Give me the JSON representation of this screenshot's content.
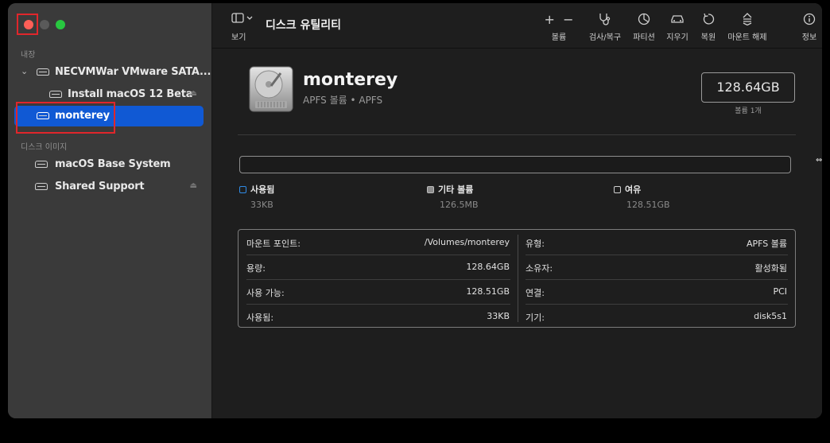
{
  "sidebar": {
    "section_internal": "내장",
    "section_disk_images": "디스크 이미지",
    "items": [
      {
        "label": "NECVMWar VMware SATA..."
      },
      {
        "label": "Install macOS 12 Beta"
      },
      {
        "label": "monterey"
      },
      {
        "label": "macOS Base System"
      },
      {
        "label": "Shared Support"
      }
    ]
  },
  "toolbar": {
    "view_label": "보기",
    "title": "디스크 유틸리티",
    "volume_label": "볼륨",
    "firstaid_label": "검사/복구",
    "partition_label": "파티션",
    "erase_label": "지우기",
    "restore_label": "복원",
    "unmount_label": "마운트 해제",
    "info_label": "정보"
  },
  "volume": {
    "name": "monterey",
    "subtitle": "APFS 볼륨 • APFS",
    "capacity": "128.64GB",
    "capacity_sub": "볼륨 1개"
  },
  "usage": {
    "legend": [
      {
        "label": "사용됨",
        "value": "33KB",
        "color": "#2f8be6"
      },
      {
        "label": "기타 볼륨",
        "value": "126.5MB",
        "color": "#8c8c8c"
      },
      {
        "label": "여유",
        "value": "128.51GB",
        "color": "#1e1e1e"
      }
    ]
  },
  "info": {
    "left": [
      {
        "key": "마운트 포인트:",
        "value": "/Volumes/monterey"
      },
      {
        "key": "용량:",
        "value": "128.64GB"
      },
      {
        "key": "사용 가능:",
        "value": "128.51GB"
      },
      {
        "key": "사용됨:",
        "value": "33KB"
      }
    ],
    "right": [
      {
        "key": "유형:",
        "value": "APFS 볼륨"
      },
      {
        "key": "소유자:",
        "value": "활성화됨"
      },
      {
        "key": "연결:",
        "value": "PCI"
      },
      {
        "key": "기기:",
        "value": "disk5s1"
      }
    ]
  },
  "colors": {
    "accent": "#1059d4",
    "highlight_box": "#e0262b"
  }
}
